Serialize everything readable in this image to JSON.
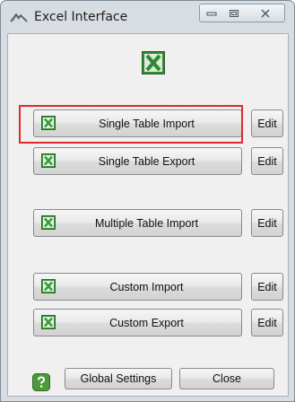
{
  "window": {
    "title": "Excel Interface",
    "controls": {
      "minimize": "minimize-icon",
      "maximize": "maximize-icon",
      "close": "close-icon"
    }
  },
  "buttons": {
    "single_import": "Single Table Import",
    "single_export": "Single Table Export",
    "multiple_import": "Multiple Table Import",
    "custom_import": "Custom Import",
    "custom_export": "Custom Export",
    "edit": "Edit",
    "global_settings": "Global Settings",
    "close": "Close"
  },
  "colors": {
    "highlight": "#e0292e",
    "excel_green": "#3a9a3a"
  }
}
